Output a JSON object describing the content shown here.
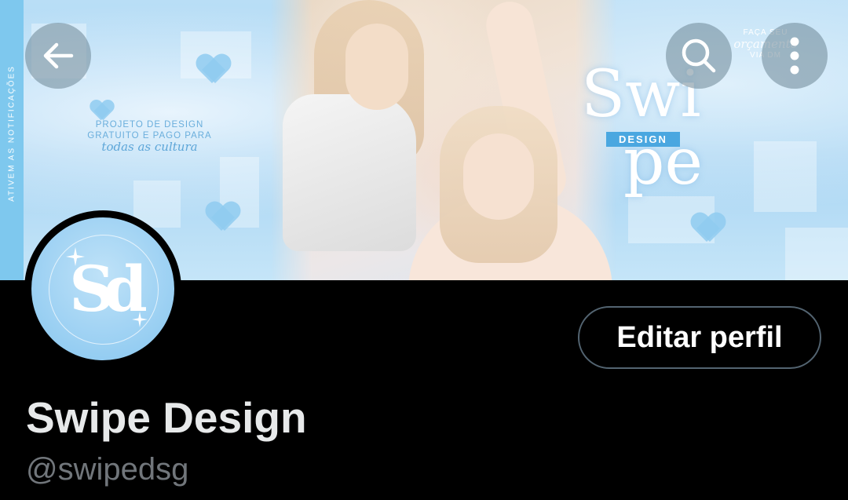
{
  "header": {
    "banner": {
      "side_strip_text": "ATIVEM AS NOTIFICAÇÕES",
      "tagline_line1": "PROJETO DE DESIGN",
      "tagline_line2": "GRATUITO E PAGO PARA",
      "tagline_script": "todas as cultura",
      "logo_top": "Swi",
      "logo_bottom": "pe",
      "logo_badge": "DESIGN",
      "promo_line1": "FAÇA SEU",
      "promo_line2": "orçamento",
      "promo_line3": "VIA DM"
    },
    "back_icon": "arrow-left-icon",
    "search_icon": "search-icon",
    "more_icon": "more-vertical-icon"
  },
  "profile": {
    "avatar_monogram": "Sd",
    "edit_button_label": "Editar perfil",
    "display_name": "Swipe Design",
    "handle": "@swipedsg"
  },
  "colors": {
    "background": "#000000",
    "banner_blue": "#a9d5f3",
    "accent_blue": "#4aa7e0",
    "name_text": "#e7e9ea",
    "handle_text": "#71767b",
    "button_border": "#536471"
  }
}
